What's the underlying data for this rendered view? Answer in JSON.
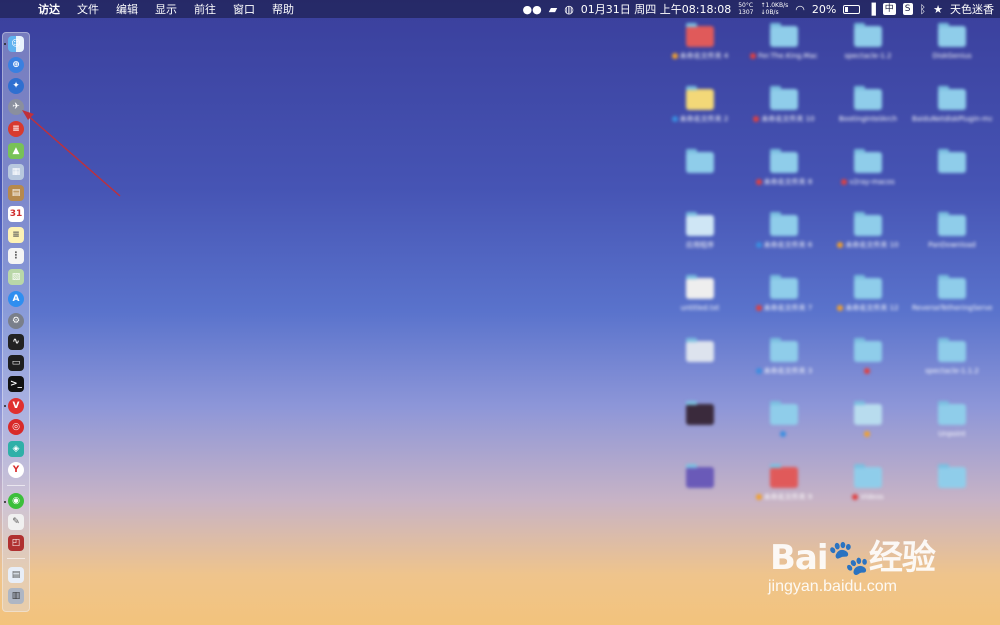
{
  "menubar": {
    "app": "访达",
    "items": [
      "文件",
      "编辑",
      "显示",
      "前往",
      "窗口",
      "帮助"
    ],
    "temp": "50°C",
    "fan": "1307",
    "net_up": "↑1.0KB/s",
    "net_down": "↓0B/s",
    "datetime": "01月31日 周四 上午08:18:08",
    "battery": "20%",
    "input": "中",
    "s_badge": "S",
    "user": "天色迷香"
  },
  "desktop": {
    "items": [
      {
        "label": "未命名文件夹 4",
        "color": "#e05a5a",
        "tag": "#f0a030"
      },
      {
        "label": "Fer.The.King.Mac",
        "color": "#8fcdea",
        "tag": "#e04040"
      },
      {
        "label": "spectacle-1.2",
        "color": "#8fcdea",
        "tag": ""
      },
      {
        "label": "DiskGenius",
        "color": "#8fcdea",
        "tag": ""
      },
      {
        "label": "未命名文件夹 2",
        "color": "#f3d878",
        "tag": "#3a8ee0"
      },
      {
        "label": "未命名文件夹 10",
        "color": "#8fcdea",
        "tag": "#e04040"
      },
      {
        "label": "BootingIntelArch",
        "color": "#8fcdea",
        "tag": ""
      },
      {
        "label": "BaiduNetdiskPlugin-master",
        "color": "#8fcdea",
        "tag": ""
      },
      {
        "label": "",
        "color": "#8fcdea",
        "tag": ""
      },
      {
        "label": "未命名文件夹 8",
        "color": "#8fcdea",
        "tag": "#e04040"
      },
      {
        "label": "v2ray-macos",
        "color": "#8fcdea",
        "tag": "#e04040"
      },
      {
        "label": "",
        "color": "#8fcdea",
        "tag": ""
      },
      {
        "label": "应用程序",
        "color": "#cfe6f5",
        "tag": ""
      },
      {
        "label": "未命名文件夹 6",
        "color": "#8fcdea",
        "tag": "#3a8ee0"
      },
      {
        "label": "未命名文件夹 10",
        "color": "#8fcdea",
        "tag": "#f0a030"
      },
      {
        "label": "PanDownload",
        "color": "#8fcdea",
        "tag": ""
      },
      {
        "label": "untitled.txt",
        "color": "#eeeeee",
        "tag": ""
      },
      {
        "label": "未命名文件夹 7",
        "color": "#8fcdea",
        "tag": "#e04040"
      },
      {
        "label": "未命名文件夹 12",
        "color": "#8fcdea",
        "tag": "#f0a030"
      },
      {
        "label": "ReverseTetheringServer",
        "color": "#8fcdea",
        "tag": ""
      },
      {
        "label": "",
        "color": "#dde3ee",
        "tag": ""
      },
      {
        "label": "未命名文件夹 3",
        "color": "#8fcdea",
        "tag": "#3a8ee0"
      },
      {
        "label": "",
        "color": "#8fcdea",
        "tag": "#e04040"
      },
      {
        "label": "spectacle-1.1.2",
        "color": "#8fcdea",
        "tag": ""
      },
      {
        "label": "",
        "color": "#3a2a3c",
        "tag": ""
      },
      {
        "label": "",
        "color": "#8fcdea",
        "tag": "#3a8ee0"
      },
      {
        "label": "",
        "color": "#b8dcee",
        "tag": "#f0a030"
      },
      {
        "label": "Unpoint",
        "color": "#8fcdea",
        "tag": ""
      },
      {
        "label": "",
        "color": "#6a5ab8",
        "tag": ""
      },
      {
        "label": "未命名文件夹 9",
        "color": "#e05a5a",
        "tag": "#f0a030"
      },
      {
        "label": "Videos",
        "color": "#8fcdea",
        "tag": "#e04040"
      },
      {
        "label": "",
        "color": "#8fcdea",
        "tag": ""
      }
    ]
  },
  "watermark": {
    "brand": "Bai🐾经验",
    "url": "jingyan.baidu.com"
  }
}
